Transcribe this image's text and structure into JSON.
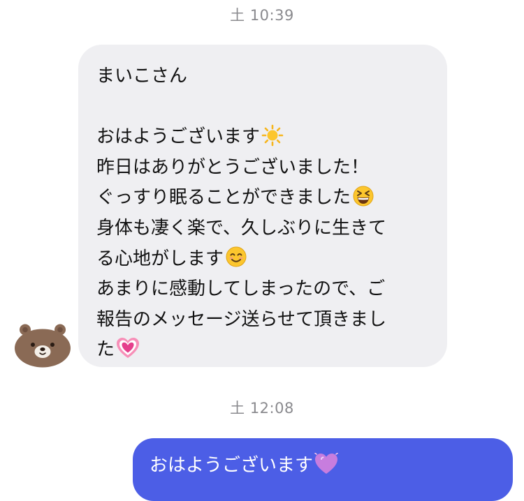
{
  "timestamps": {
    "first": "土 10:39",
    "second": "土 12:08"
  },
  "incoming": {
    "avatar_icon": "brown-bear-face-icon",
    "lines": {
      "l1": "まいこさん",
      "l2": "おはようございます",
      "l3": "昨日はありがとうございました！",
      "l4": "ぐっすり眠ることができました",
      "l5": "身体も凄く楽で、久しぶりに生きて",
      "l6": "る心地がします",
      "l7": "あまりに感動してしまったので、ご",
      "l8": "報告のメッセージ送らせて頂きまし",
      "l9": "た"
    },
    "emojis": {
      "l2": "sun-emoji",
      "l4": "grinning-squinting-face-emoji",
      "l6": "smiling-face-emoji",
      "l9": "growing-heart-emoji"
    }
  },
  "outgoing": {
    "text": "おはようございます",
    "emoji": "purple-heart-emoji"
  },
  "colors": {
    "incoming_bubble": "#efeff2",
    "outgoing_bubble": "#4c5ee6",
    "timestamp": "#8a8a8e"
  }
}
